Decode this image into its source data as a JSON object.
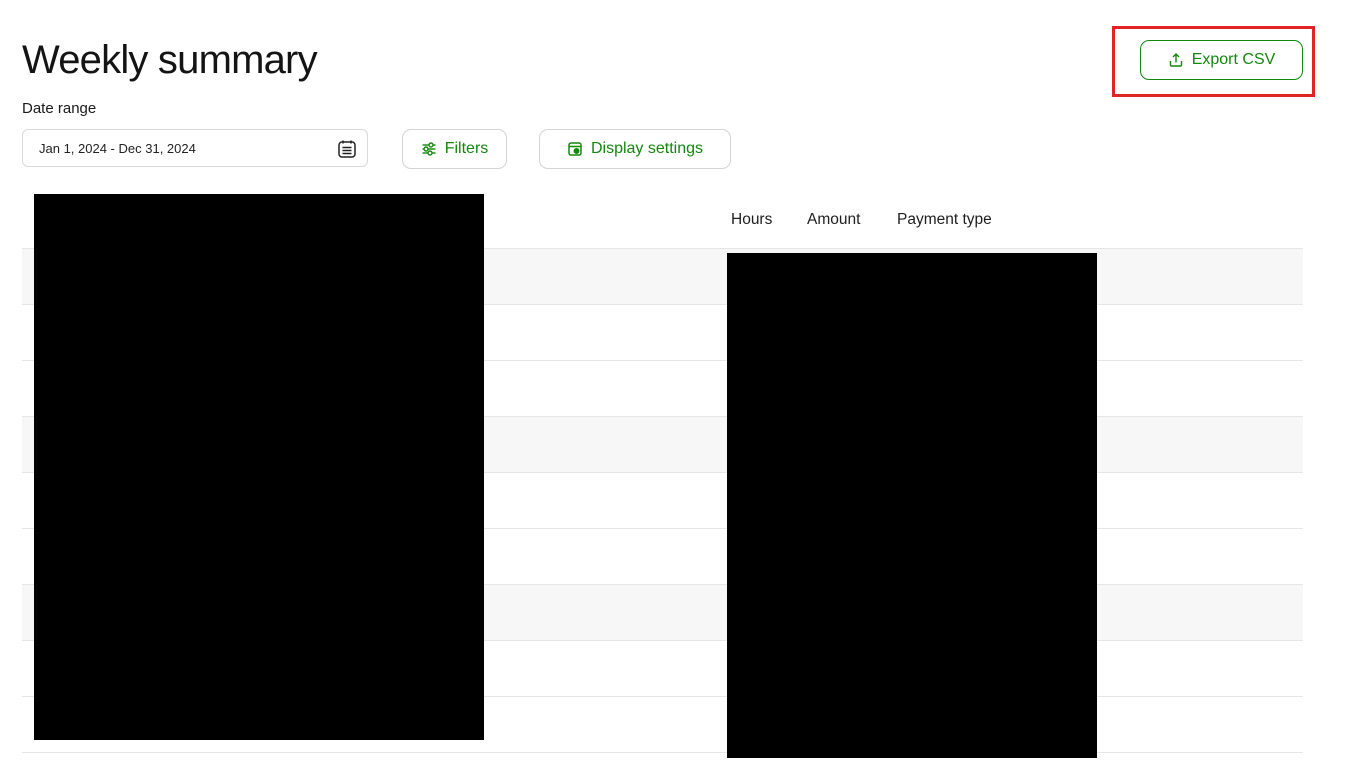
{
  "page": {
    "title": "Weekly summary",
    "date_range_label": "Date range",
    "date_range_value": "Jan 1, 2024 - Dec 31, 2024"
  },
  "toolbar": {
    "filters_label": "Filters",
    "display_settings_label": "Display settings",
    "export_label": "Export CSV"
  },
  "icons": {
    "calendar": "calendar-icon",
    "filters": "sliders-icon",
    "display_settings": "display-settings-icon",
    "export": "upload-icon"
  },
  "colors": {
    "accent": "#14870e",
    "highlight": "#e02424",
    "redaction": "#000000"
  },
  "table": {
    "columns": [
      "Hours",
      "Amount",
      "Payment type"
    ],
    "row_count": 9
  }
}
